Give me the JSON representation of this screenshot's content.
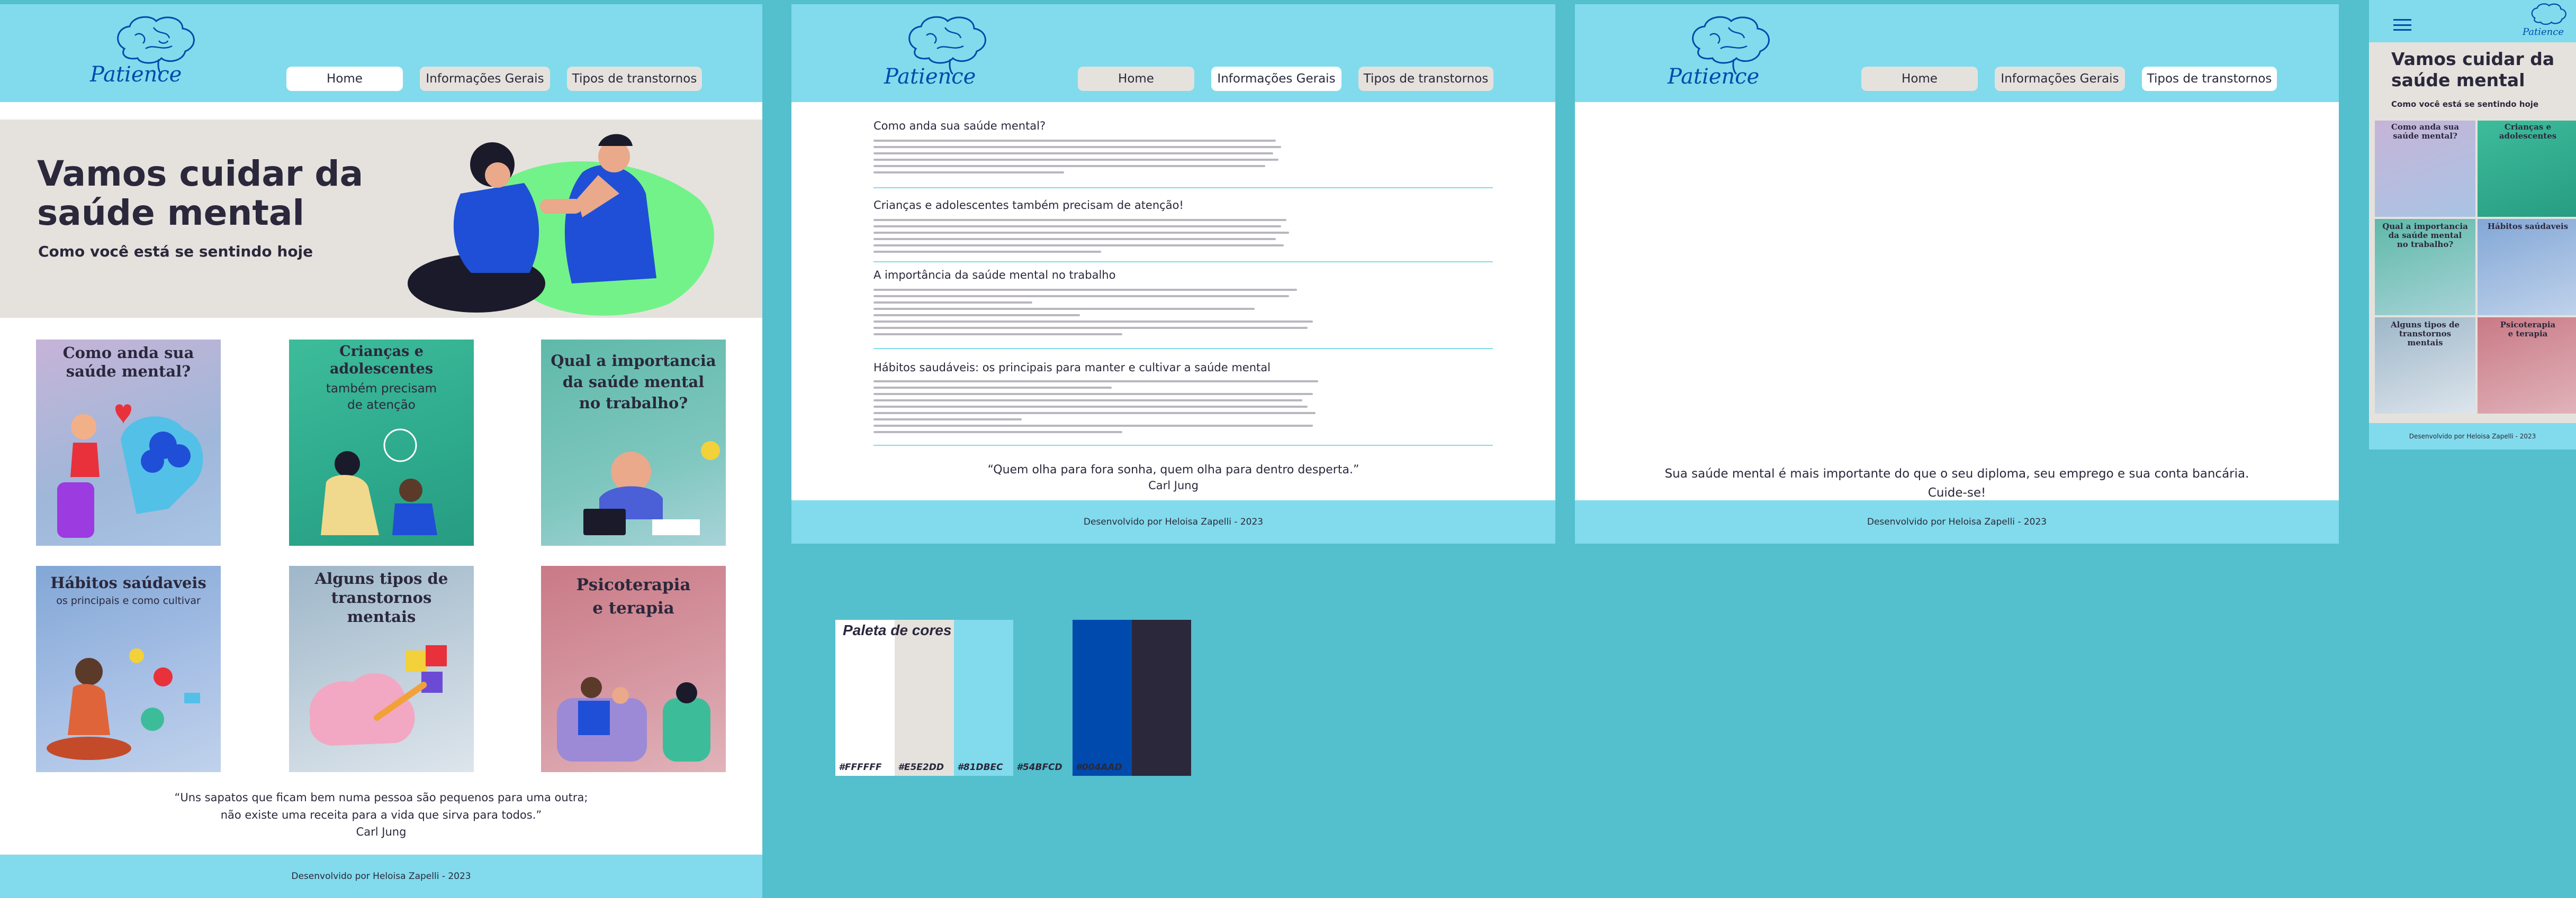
{
  "brand": {
    "name": "Patience"
  },
  "nav": {
    "home": "Home",
    "info": "Informações Gerais",
    "types": "Tipos de transtornos"
  },
  "footer": "Desenvolvido por Heloisa Zapelli - 2023",
  "home": {
    "hero_title": "Vamos cuidar da\nsaúde mental",
    "hero_subtitle": "Como você está se sentindo hoje",
    "cards": [
      {
        "title": "Como anda sua\nsaúde mental?",
        "sub": ""
      },
      {
        "title": "Crianças e\nadolescentes",
        "sub": "também precisam\nde atenção"
      },
      {
        "title": "Qual a importancia\nda saúde mental\nno trabalho?",
        "sub": ""
      },
      {
        "title": "Hábitos saúdaveis",
        "sub": "os principais e como cultivar"
      },
      {
        "title": "Alguns tipos de\ntranstornos\nmentais",
        "sub": ""
      },
      {
        "title": "Psicoterapia\ne terapia",
        "sub": ""
      }
    ],
    "quote": "“Uns sapatos que ficam bem numa pessoa são pequenos para uma outra;\nnão existe uma receita para a vida que sirva para todos.”",
    "quote_author": "Carl Jung"
  },
  "info": {
    "sections": [
      "Como anda sua saúde mental?",
      "Crianças e adolescentes também precisam de atenção!",
      "A importância da saúde mental no trabalho",
      "Hábitos saudáveis: os principais para manter e cultivar a saúde mental"
    ],
    "quote": "“Quem olha para fora sonha, quem olha para dentro desperta.”",
    "quote_author": "Carl Jung"
  },
  "types": {
    "message": "Sua saúde mental é mais importante do que o seu diploma, seu emprego e sua conta bancária.\nCuide-se!"
  },
  "mobile": {
    "hero_title": "Vamos cuidar da\nsaúde mental",
    "hero_subtitle": "Como você está se sentindo hoje",
    "cards": [
      "Como anda sua\nsaúde mental?",
      "Crianças e\nadolescentes",
      "Qual a importancia\nda saúde mental\nno trabalho?",
      "Hábitos saúdaveis",
      "Alguns tipos de\ntranstornos\nmentais",
      "Psicoterapia\ne terapia"
    ]
  },
  "palette": {
    "title": "Paleta de cores",
    "colors": [
      {
        "hex": "#FFFFFF",
        "label": "#FFFFFF"
      },
      {
        "hex": "#E5E2DD",
        "label": "#E5E2DD"
      },
      {
        "hex": "#81DBEC",
        "label": "#81DBEC"
      },
      {
        "hex": "#54BFCD",
        "label": "#54BFCD"
      },
      {
        "hex": "#004AAD",
        "label": "#004AAD"
      },
      {
        "hex": "#2B283C",
        "label": "#2B283C"
      }
    ]
  }
}
